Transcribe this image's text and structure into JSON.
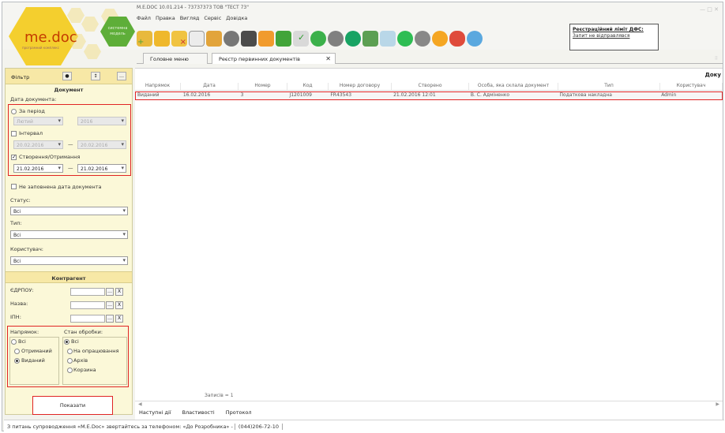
{
  "app": {
    "title": "M.E.DOC 10.01.214 - 73737373 ТОВ \"ТЕСТ 73\"",
    "logo": "me.doc",
    "logo_subtitle": "програмний комплекс",
    "brand_badge": "системна\nмодель",
    "window_controls": "— □ ✕"
  },
  "menu": [
    "Файл",
    "Правка",
    "Вигляд",
    "Сервіс",
    "Довідка"
  ],
  "notice": {
    "title": "Реєстраційний ліміт ДФС:",
    "text": "Запит не відправлявся"
  },
  "tabs": [
    {
      "label": "Головне меню"
    },
    {
      "label": "Реєстр первинних документів",
      "close": "✕"
    }
  ],
  "filter": {
    "header_label": "Фільтр",
    "document_title": "Документ",
    "date_label": "Дата документа:",
    "period_label": "За період",
    "period_month": "Лютий",
    "period_year": "2016",
    "interval_label": "Інтервал",
    "interval_from": "20.02.2016",
    "interval_to": "20.02.2016",
    "created_label": "Створення/Отримання",
    "created_from": "21.02.2016",
    "created_to": "21.02.2016",
    "no_date_label": "Не заповнена дата документа",
    "status_label": "Статус:",
    "status_value": "Всі",
    "type_label": "Тип:",
    "type_value": "Всі",
    "user_label": "Користувач:",
    "user_value": "Всі",
    "contractor_title": "Контрагент",
    "edrpou_label": "ЄДРПОУ:",
    "name_label": "Назва:",
    "ipn_label": "ІПН:",
    "direction_title": "Напрямок:",
    "direction_all": "Всі",
    "direction_received": "Отриманий",
    "direction_issued": "Виданий",
    "processing_title": "Стан обробки:",
    "processing_all": "Всі",
    "processing_pending": "На опрацювання",
    "processing_archive": "Архів",
    "processing_trash": "Корзина",
    "show_button": "Показати"
  },
  "grid": {
    "title": "Доку",
    "columns": [
      "Напрямок",
      "Дата",
      "Номер",
      "Код",
      "Номер договору",
      "Створено",
      "Особа, яка склала документ",
      "Тип",
      "Користувач"
    ],
    "row": [
      "Виданий",
      "16.02.2016",
      "3",
      "J1201009",
      "FR43543",
      "21.02.2016 12:01",
      "В. С. Адміненко",
      "Податкова накладна",
      "Admin"
    ],
    "records": "Записів = 1"
  },
  "bottom_tabs": [
    "Наступні дії",
    "Властивості",
    "Протокол"
  ],
  "status": {
    "text": "З питань супроводження «M.E.Doc» звертайтесь за телефоном: «До Розробника» -",
    "phone": "(044)206-72-10"
  }
}
